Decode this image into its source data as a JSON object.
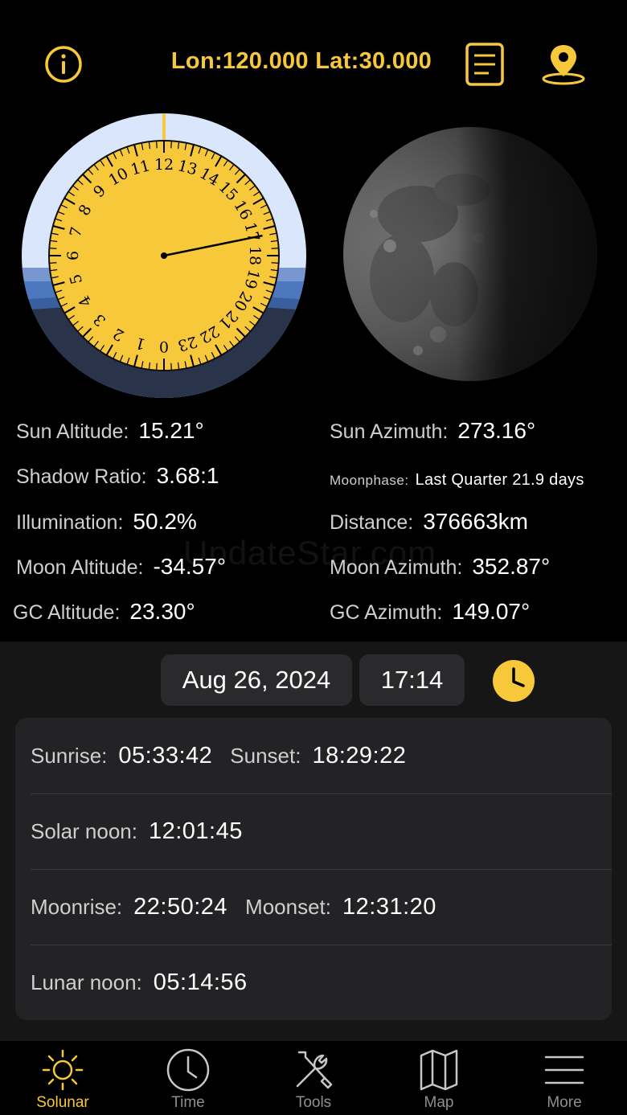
{
  "header": {
    "coords": "Lon:120.000 Lat:30.000",
    "info_icon": "info-circle-icon",
    "list_icon": "document-list-icon",
    "location_icon": "map-pin-icon"
  },
  "dial": {
    "hours": [
      "0",
      "1",
      "2",
      "3",
      "4",
      "5",
      "6",
      "7",
      "8",
      "9",
      "10",
      "11",
      "12",
      "13",
      "14",
      "15",
      "16",
      "17",
      "18",
      "19",
      "20",
      "21",
      "22",
      "23"
    ],
    "current_time": "17:14",
    "colors": {
      "face": "#f7c83a",
      "sky": "#d9e6fb",
      "twilight": "#4d78c0",
      "night": "#29344a"
    }
  },
  "moon": {
    "phase": "Last Quarter",
    "image_icon": "moon-phase-icon"
  },
  "info": {
    "left": [
      {
        "label": "Sun Altitude:",
        "value": "15.21°"
      },
      {
        "label": "Shadow Ratio:",
        "value": "3.68:1"
      },
      {
        "label": "Illumination:",
        "value": "50.2%"
      },
      {
        "label": "Moon Altitude:",
        "value": "-34.57°"
      },
      {
        "label": "GC Altitude:",
        "value": "23.30°"
      }
    ],
    "right": [
      {
        "label": "Sun Azimuth:",
        "value": "273.16°"
      },
      {
        "label": "Moonphase:",
        "value": "Last Quarter 21.9 days"
      },
      {
        "label": "Distance:",
        "value": "376663km"
      },
      {
        "label": "Moon Azimuth:",
        "value": "352.87°"
      },
      {
        "label": "GC Azimuth:",
        "value": "149.07°"
      }
    ]
  },
  "watermark": "UpdateStar.com",
  "datetime": {
    "date": "Aug 26, 2024",
    "time": "17:14",
    "clock_icon": "clock-icon"
  },
  "times": {
    "sunrise_label": "Sunrise:",
    "sunrise": "05:33:42",
    "sunset_label": "Sunset:",
    "sunset": "18:29:22",
    "solar_noon_label": "Solar noon:",
    "solar_noon": "12:01:45",
    "moonrise_label": "Moonrise:",
    "moonrise": "22:50:24",
    "moonset_label": "Moonset:",
    "moonset": "12:31:20",
    "lunar_noon_label": "Lunar noon:",
    "lunar_noon": "05:14:56"
  },
  "tabs": [
    {
      "label": "Solunar",
      "icon": "sun-icon",
      "active": true
    },
    {
      "label": "Time",
      "icon": "clock-icon",
      "active": false
    },
    {
      "label": "Tools",
      "icon": "tools-icon",
      "active": false
    },
    {
      "label": "Map",
      "icon": "map-icon",
      "active": false
    },
    {
      "label": "More",
      "icon": "menu-icon",
      "active": false
    }
  ],
  "colors": {
    "accent": "#f7c83a",
    "background": "#000000",
    "panel": "#161616",
    "card": "#232325"
  }
}
